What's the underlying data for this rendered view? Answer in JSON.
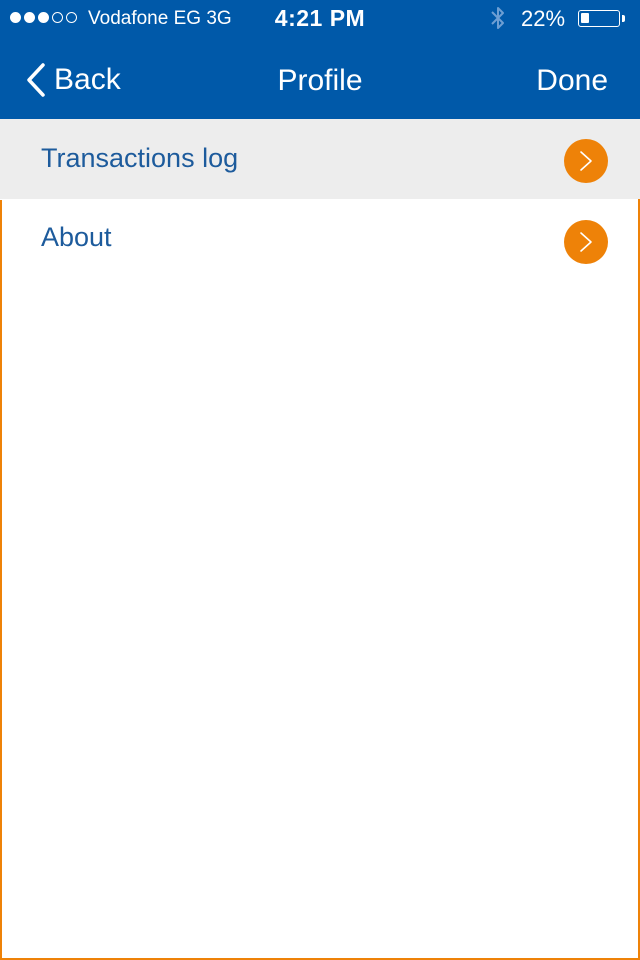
{
  "status_bar": {
    "signal_bars_filled": 3,
    "signal_bars_total": 5,
    "carrier": "Vodafone EG 3G",
    "time": "4:21 PM",
    "bluetooth_icon": "bluetooth-icon",
    "battery_percent_label": "22%",
    "battery_level": 0.22
  },
  "nav_bar": {
    "back_label": "Back",
    "title": "Profile",
    "done_label": "Done"
  },
  "menu": {
    "items": [
      {
        "label": "Transactions log",
        "icon": "chevron-right-icon",
        "highlighted": true
      },
      {
        "label": "About",
        "icon": "chevron-right-icon",
        "highlighted": false
      }
    ]
  },
  "colors": {
    "header_bg": "#0059A9",
    "accent_orange": "#EE8208",
    "item_text": "#1D5B9C",
    "highlight_bg": "#EDEDED"
  }
}
